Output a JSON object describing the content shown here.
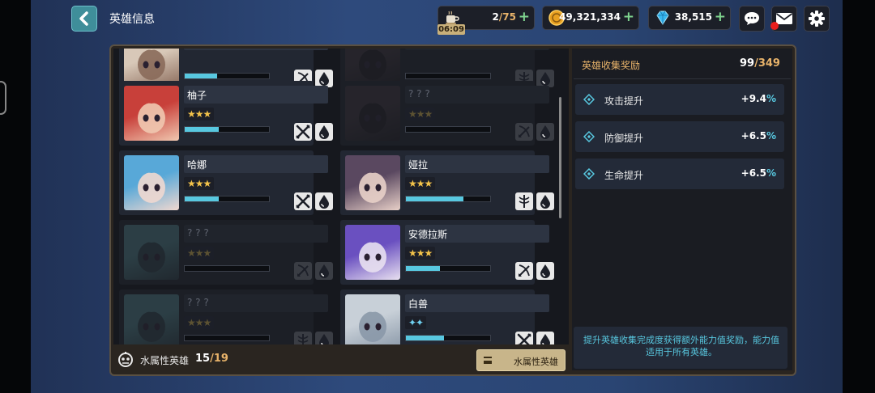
{
  "header": {
    "title": "英雄信息"
  },
  "resources": {
    "stamina": {
      "current": "2",
      "sep_max": "/75",
      "timer": "06:09",
      "icon": "coffee-cup-icon"
    },
    "gold": {
      "amount": "49,321,334",
      "icon": "gold-coin-icon"
    },
    "gems": {
      "amount": "38,515",
      "icon": "diamond-icon"
    },
    "plus": "+"
  },
  "buttons": {
    "chat_icon": "chat-bubble-icon",
    "mail_icon": "envelope-icon",
    "settings_icon": "gear-icon"
  },
  "heroes": [
    {
      "name": "",
      "stars": "",
      "exp": 0.38,
      "locked": false,
      "role": "bow",
      "palette": "pale"
    },
    {
      "name": "",
      "stars": "",
      "exp": 0.0,
      "locked": true,
      "role": "staff",
      "palette": "dark"
    },
    {
      "name": "柚子",
      "stars": "★★★",
      "exp": 0.4,
      "locked": false,
      "role": "swords",
      "palette": "red"
    },
    {
      "name": "? ? ?",
      "stars": "★★★",
      "exp": 0.0,
      "locked": true,
      "role": "bow",
      "palette": "dark"
    },
    {
      "name": "哈娜",
      "stars": "★★★",
      "exp": 0.4,
      "locked": false,
      "role": "swords",
      "palette": "blue"
    },
    {
      "name": "娅拉",
      "stars": "★★★",
      "exp": 0.68,
      "locked": false,
      "role": "staff",
      "palette": "purple"
    },
    {
      "name": "? ? ?",
      "stars": "★★★",
      "exp": 0.0,
      "locked": true,
      "role": "bow",
      "palette": "teal"
    },
    {
      "name": "安德拉斯",
      "stars": "★★★",
      "exp": 0.4,
      "locked": false,
      "role": "bow",
      "palette": "violet"
    },
    {
      "name": "? ? ?",
      "stars": "★★★",
      "exp": 0.0,
      "locked": true,
      "role": "staff",
      "palette": "teal"
    },
    {
      "name": "白兽",
      "stars": "✦✦",
      "exp": 0.45,
      "locked": false,
      "role": "swords",
      "palette": "white",
      "star_style": "blue"
    }
  ],
  "footer": {
    "label": "水属性英雄",
    "count": "15",
    "max": "/19",
    "filter_label": "水属性英雄"
  },
  "reward": {
    "title": "英雄收集奖励",
    "count": "99",
    "max": "/349",
    "bonuses": [
      {
        "label": "攻击提升",
        "value": "+9.4",
        "unit": "%"
      },
      {
        "label": "防御提升",
        "value": "+6.5",
        "unit": "%"
      },
      {
        "label": "生命提升",
        "value": "+6.5",
        "unit": "%"
      }
    ],
    "description": "提升英雄收集完成度获得额外能力值奖励，能力值适用于所有英雄。"
  },
  "colors": {
    "accent_gold": "#e8b36a",
    "accent_cyan": "#58c8e0",
    "plus_green": "#7fd58f"
  }
}
